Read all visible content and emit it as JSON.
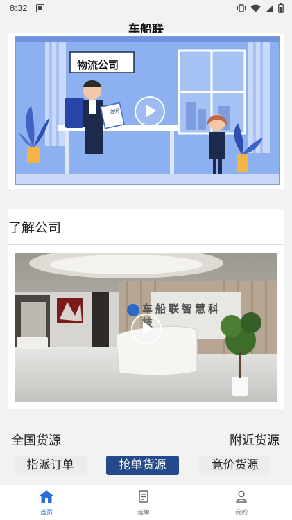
{
  "status_bar": {
    "time": "8:32"
  },
  "header": {
    "title": "车船联"
  },
  "banner": {
    "sign_text": "物流公司",
    "doc_text": "合同"
  },
  "company": {
    "title": "了解公司",
    "wall_sign": "车船联智慧科技"
  },
  "cargo": {
    "national": "全国货源",
    "nearby": "附近货源",
    "tabs": [
      {
        "label": "指派订单",
        "active": false
      },
      {
        "label": "抢单货源",
        "active": true
      },
      {
        "label": "竞价货源",
        "active": false
      }
    ]
  },
  "nav": {
    "items": [
      {
        "label": "首页",
        "icon": "home-icon",
        "active": true
      },
      {
        "label": "运单",
        "icon": "waybill-icon",
        "active": false
      },
      {
        "label": "我的",
        "icon": "user-icon",
        "active": false
      }
    ]
  },
  "colors": {
    "accent": "#244a8a",
    "nav_active": "#2b6fd6",
    "banner_bg": "#8fb0ef"
  }
}
